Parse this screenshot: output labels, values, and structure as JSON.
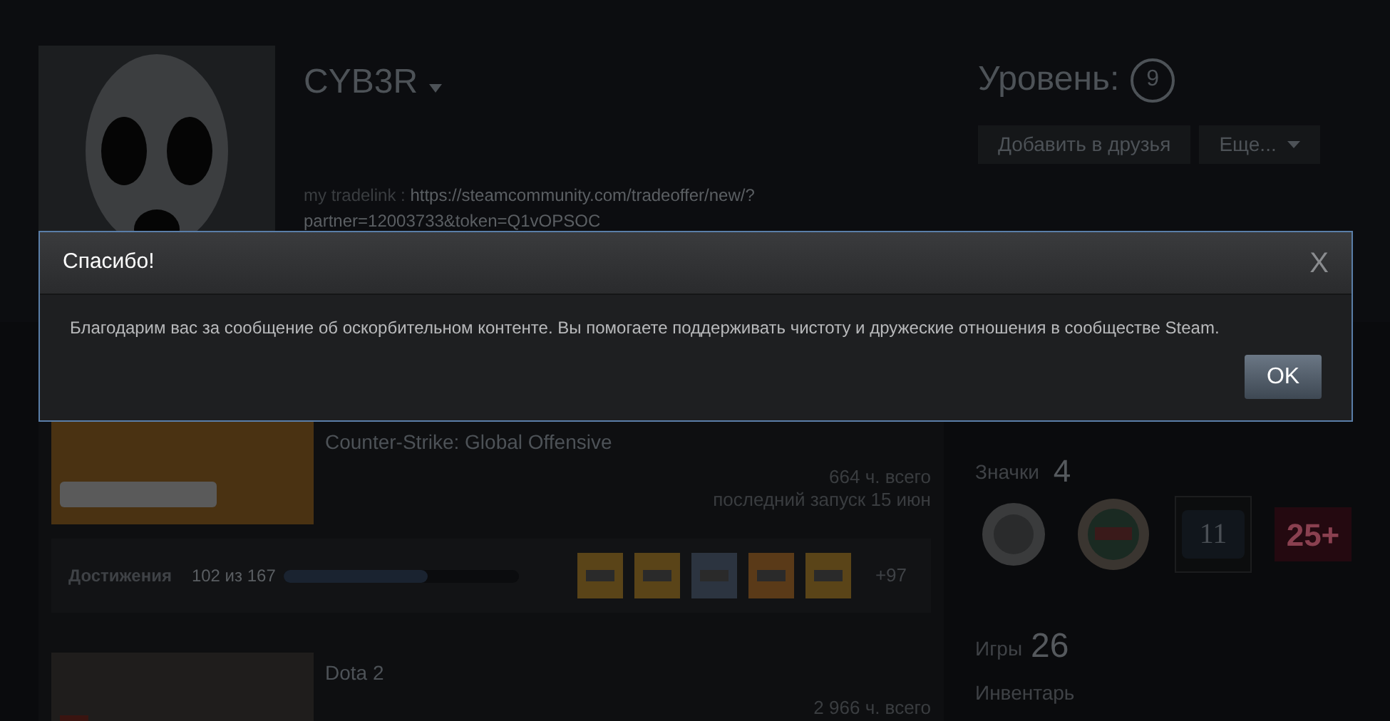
{
  "profile": {
    "name": "CYB3R",
    "level_label": "Уровень:",
    "level": "9",
    "summary_label": "my tradelink :",
    "summary_link_lines": [
      "https://steamcommunity.com/tradeoffer/new/?",
      "partner=12003733&token=Q1vOPSOC"
    ],
    "buttons": [
      {
        "label": "Добавить в друзья",
        "kind": "plain"
      },
      {
        "label": "Еще...",
        "kind": "dropdown"
      }
    ]
  },
  "games": [
    {
      "kind": "csgo",
      "title": "Counter-Strike: Global Offensive",
      "hours": "664 ч. всего",
      "last_played": "последний запуск 15 июн",
      "achievements": {
        "label": "Достижения",
        "count": "102 из 167",
        "level": 0.61,
        "more": "+97"
      }
    },
    {
      "kind": "dota",
      "title": "Dota 2",
      "hours": "2 966 ч. всего"
    }
  ],
  "sidebar": {
    "badges_label": "Значки",
    "badges_count": "4",
    "badges": [
      {
        "kind": "coin"
      },
      {
        "kind": "porthole"
      },
      {
        "kind": "years",
        "text": "11"
      },
      {
        "kind": "level",
        "text": "25+"
      }
    ],
    "games_label": "Игры",
    "games_count": "26",
    "inventory_label": "Инвентарь"
  },
  "dialog": {
    "title": "Спасибо!",
    "close": "X",
    "message": "Благодарим вас за сообщение об оскорбительном контенте. Вы помогаете поддерживать чистоту и дружеские отношения в сообществе Steam.",
    "ok": "OK"
  }
}
